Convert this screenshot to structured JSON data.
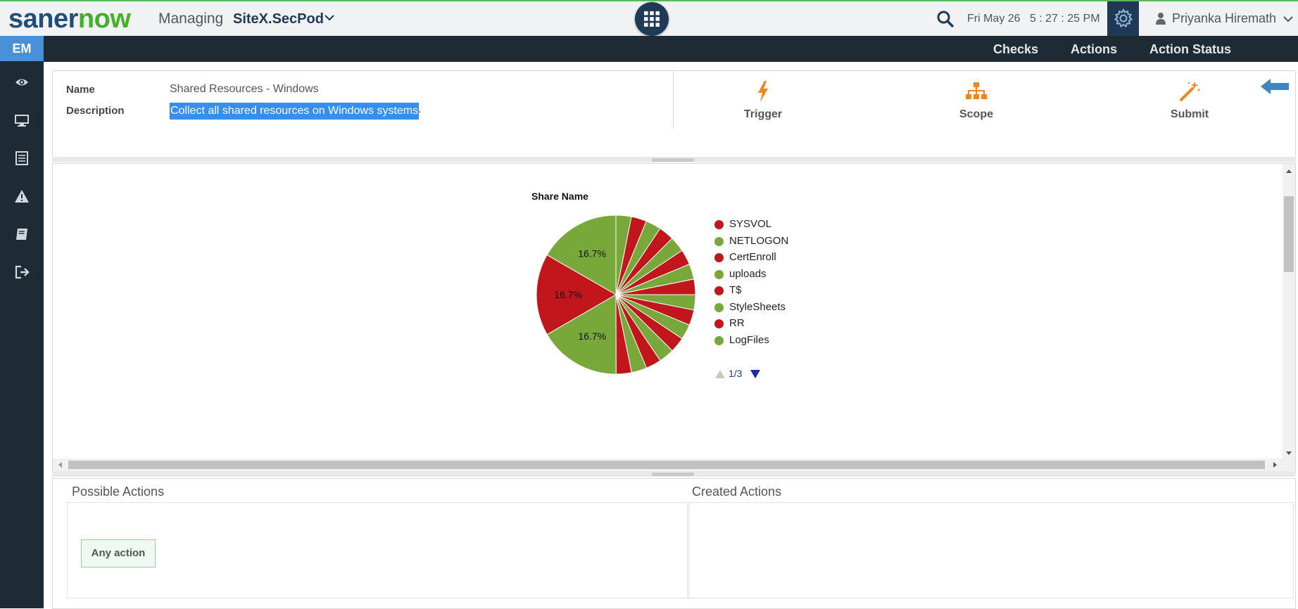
{
  "header": {
    "logo_part1": "saner",
    "logo_part2": "now",
    "managing_label": "Managing",
    "site_name": "SiteX.SecPod",
    "datetime": "Fri May 26   5 : 27 : 25 PM",
    "user_name": "Priyanka Hiremath",
    "icons": [
      "chevron-down-icon",
      "apps-grid-icon",
      "search-icon",
      "gear-icon",
      "user-icon"
    ]
  },
  "sidebar": {
    "badge": "EM",
    "items": [
      {
        "icon": "eye-icon"
      },
      {
        "icon": "monitor-icon"
      },
      {
        "icon": "list-icon"
      },
      {
        "icon": "warning-icon"
      },
      {
        "icon": "book-icon"
      },
      {
        "icon": "logout-icon"
      }
    ]
  },
  "nav": {
    "items": [
      "Checks",
      "Actions",
      "Action Status"
    ],
    "home_icon": "home-icon"
  },
  "info": {
    "name_label": "Name",
    "name_value": "Shared Resources - Windows",
    "description_label": "Description",
    "description_value": "Collect all shared resources on Windows systems",
    "description_suffix": ".",
    "tools": [
      {
        "label": "Trigger",
        "icon": "lightning-icon"
      },
      {
        "label": "Scope",
        "icon": "hierarchy-icon"
      },
      {
        "label": "Submit",
        "icon": "magic-wand-icon"
      }
    ],
    "back_icon": "back-arrow-icon"
  },
  "chart_data": {
    "type": "pie",
    "title": "Share Name",
    "slices": [
      {
        "label": "",
        "value": 16.7,
        "display": "16.7%",
        "color": "#78a73a"
      },
      {
        "label": "",
        "value": 16.7,
        "display": "16.7%",
        "color": "#c0161c"
      },
      {
        "label": "",
        "value": 16.7,
        "display": "16.7%",
        "color": "#78a73a"
      },
      {
        "label": "",
        "value": 50.0,
        "display": "",
        "split": 16,
        "colors": [
          "#c0161c",
          "#78a73a"
        ]
      }
    ],
    "legend": [
      {
        "label": "SYSVOL",
        "color": "#c0161c"
      },
      {
        "label": "NETLOGON",
        "color": "#78a73a"
      },
      {
        "label": "CertEnroll",
        "color": "#c0161c"
      },
      {
        "label": "uploads",
        "color": "#78a73a"
      },
      {
        "label": "T$",
        "color": "#c0161c"
      },
      {
        "label": "StyleSheets",
        "color": "#78a73a"
      },
      {
        "label": "RR",
        "color": "#c0161c"
      },
      {
        "label": "LogFiles",
        "color": "#78a73a"
      }
    ],
    "legend_page": "1/3"
  },
  "bottom": {
    "possible_actions_title": "Possible Actions",
    "any_action_label": "Any action",
    "created_actions_title": "Created Actions"
  }
}
